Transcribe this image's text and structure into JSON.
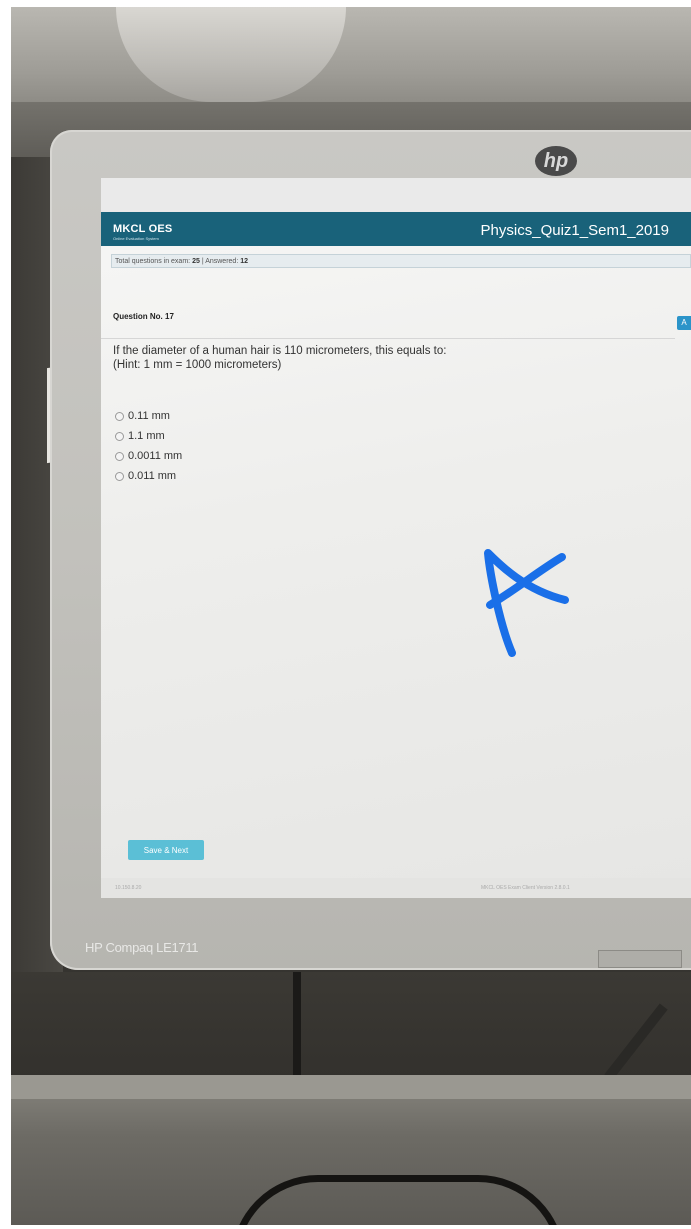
{
  "monitor": {
    "brand_label": "HP Compaq LE1711",
    "logo_text": "hp"
  },
  "app": {
    "logo": "MKCL OES",
    "logo_subtitle": "Online Evaluation System",
    "exam_title": "Physics_Quiz1_Sem1_2019"
  },
  "status": {
    "total_label": "Total questions in exam:",
    "total_value": "25",
    "answered_label": "| Answered:",
    "answered_value": "12"
  },
  "question": {
    "number": "Question No. 17",
    "text_line1": "If the diameter of a human hair is 110 micrometers, this equals to:",
    "text_line2": "(Hint: 1 mm = 1000 micrometers)",
    "options": [
      "0.11 mm",
      "1.1 mm",
      "0.0011 mm",
      "0.011 mm"
    ],
    "flag_label": "A"
  },
  "actions": {
    "save_next": "Save & Next"
  },
  "footer": {
    "ip": "10.150.8.20",
    "version": "MKCL OES Exam Client Version 2.8.0.1"
  },
  "annotation": {
    "handwritten_letter": "A",
    "color": "#1a6fe8"
  }
}
